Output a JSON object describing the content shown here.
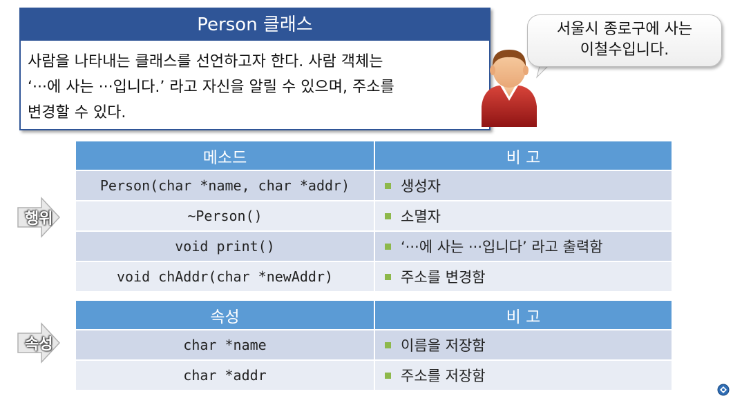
{
  "header": {
    "title": "Person 클래스",
    "body_lines": [
      "사람을 나타내는 클래스를 선언하고자 한다. 사람 객체는",
      "‘···에 사는 ···입니다.’ 라고 자신을 알릴 수 있으며, 주소를",
      "변경할 수 있다."
    ]
  },
  "speech_bubble": {
    "lines": [
      "서울시 종로구에 사는",
      "이철수입니다."
    ]
  },
  "methods_table": {
    "side_label": "행위",
    "headers": [
      "메소드",
      "비 고"
    ],
    "rows": [
      {
        "name": "Person(char *name, char *addr)",
        "note": "생성자"
      },
      {
        "name": "~Person()",
        "note": "소멸자"
      },
      {
        "name": "void print()",
        "note": "‘···에 사는 ···입니다’ 라고 출력함"
      },
      {
        "name": "void chAddr(char *newAddr)",
        "note": "주소를 변경함"
      }
    ]
  },
  "attributes_table": {
    "side_label": "속성",
    "headers": [
      "속성",
      "비 고"
    ],
    "rows": [
      {
        "name": "char *name",
        "note": "이름을 저장함"
      },
      {
        "name": "char *addr",
        "note": "주소를 저장함"
      }
    ]
  },
  "colors": {
    "title_bar": "#2f5597",
    "table_header": "#5b9bd5",
    "row_odd": "#cfd7e8",
    "row_even": "#e8ecf4",
    "bullet": "#8db84a"
  }
}
